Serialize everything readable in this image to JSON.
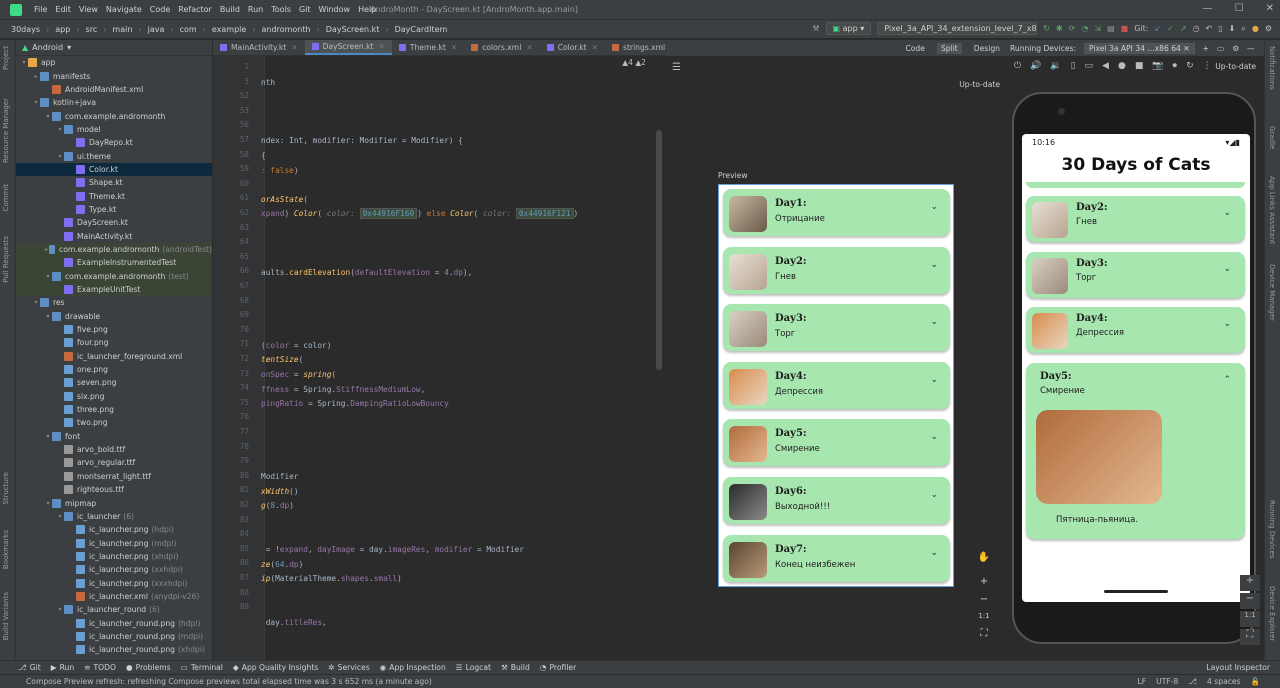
{
  "menu": {
    "items": [
      "File",
      "Edit",
      "View",
      "Navigate",
      "Code",
      "Refactor",
      "Build",
      "Run",
      "Tools",
      "Git",
      "Window",
      "Help"
    ],
    "title": "AndroMonth - DayScreen.kt [AndroMonth.app.main]"
  },
  "breadcrumb": [
    "30days",
    "app",
    "src",
    "main",
    "java",
    "com",
    "example",
    "andromonth",
    "DayScreen.kt",
    "DayCardItem"
  ],
  "toolbar": {
    "config": "app",
    "device": "Pixel_3a_API_34_extension_level_7_x86_64",
    "git": "Git:"
  },
  "project": {
    "view": "Android"
  },
  "tree": [
    {
      "l": "app",
      "d": 0,
      "a": "▾",
      "c": "#e8a84a"
    },
    {
      "l": "manifests",
      "d": 1,
      "a": "▸",
      "c": "#5d8fc4"
    },
    {
      "l": "AndroidManifest.xml",
      "d": 2,
      "a": "",
      "c": "#c46a3e"
    },
    {
      "l": "kotlin+java",
      "d": 1,
      "a": "▾",
      "c": "#5d8fc4"
    },
    {
      "l": "com.example.andromonth",
      "d": 2,
      "a": "▾",
      "c": "#5d8fc4"
    },
    {
      "l": "model",
      "d": 3,
      "a": "▾",
      "c": "#5d8fc4"
    },
    {
      "l": "DayRepo.kt",
      "d": 4,
      "a": "",
      "c": "#7f6df2"
    },
    {
      "l": "ui.theme",
      "d": 3,
      "a": "▾",
      "c": "#5d8fc4"
    },
    {
      "l": "Color.kt",
      "d": 4,
      "a": "",
      "c": "#7f6df2",
      "sel": true
    },
    {
      "l": "Shape.kt",
      "d": 4,
      "a": "",
      "c": "#7f6df2"
    },
    {
      "l": "Theme.kt",
      "d": 4,
      "a": "",
      "c": "#7f6df2"
    },
    {
      "l": "Type.kt",
      "d": 4,
      "a": "",
      "c": "#7f6df2"
    },
    {
      "l": "DayScreen.kt",
      "d": 3,
      "a": "",
      "c": "#7f6df2"
    },
    {
      "l": "MainActivity.kt",
      "d": 3,
      "a": "",
      "c": "#7f6df2"
    },
    {
      "l": "com.example.andromonth",
      "d": 2,
      "a": "▸",
      "c": "#5d8fc4",
      "hint": "(androidTest)",
      "test": true
    },
    {
      "l": "ExampleInstrumentedTest",
      "d": 3,
      "a": "",
      "c": "#7f6df2",
      "test": true
    },
    {
      "l": "com.example.andromonth",
      "d": 2,
      "a": "▾",
      "c": "#5d8fc4",
      "hint": "(test)",
      "test": true
    },
    {
      "l": "ExampleUnitTest",
      "d": 3,
      "a": "",
      "c": "#7f6df2",
      "test": true
    },
    {
      "l": "res",
      "d": 1,
      "a": "▾",
      "c": "#5d8fc4"
    },
    {
      "l": "drawable",
      "d": 2,
      "a": "▾",
      "c": "#5d8fc4"
    },
    {
      "l": "five.png",
      "d": 3,
      "a": "",
      "c": "#6a9fd4"
    },
    {
      "l": "four.png",
      "d": 3,
      "a": "",
      "c": "#6a9fd4"
    },
    {
      "l": "ic_launcher_foreground.xml",
      "d": 3,
      "a": "",
      "c": "#c46a3e"
    },
    {
      "l": "one.png",
      "d": 3,
      "a": "",
      "c": "#6a9fd4"
    },
    {
      "l": "seven.png",
      "d": 3,
      "a": "",
      "c": "#6a9fd4"
    },
    {
      "l": "six.png",
      "d": 3,
      "a": "",
      "c": "#6a9fd4"
    },
    {
      "l": "three.png",
      "d": 3,
      "a": "",
      "c": "#6a9fd4"
    },
    {
      "l": "two.png",
      "d": 3,
      "a": "",
      "c": "#6a9fd4"
    },
    {
      "l": "font",
      "d": 2,
      "a": "▾",
      "c": "#5d8fc4"
    },
    {
      "l": "arvo_bold.ttf",
      "d": 3,
      "a": "",
      "c": "#9a9a9a"
    },
    {
      "l": "arvo_regular.ttf",
      "d": 3,
      "a": "",
      "c": "#9a9a9a"
    },
    {
      "l": "montserrat_light.ttf",
      "d": 3,
      "a": "",
      "c": "#9a9a9a"
    },
    {
      "l": "righteous.ttf",
      "d": 3,
      "a": "",
      "c": "#9a9a9a"
    },
    {
      "l": "mipmap",
      "d": 2,
      "a": "▾",
      "c": "#5d8fc4"
    },
    {
      "l": "ic_launcher",
      "d": 3,
      "a": "▾",
      "c": "#5d8fc4",
      "hint": "(6)"
    },
    {
      "l": "ic_launcher.png",
      "d": 4,
      "a": "",
      "c": "#6a9fd4",
      "hint": "(hdpi)"
    },
    {
      "l": "ic_launcher.png",
      "d": 4,
      "a": "",
      "c": "#6a9fd4",
      "hint": "(mdpi)"
    },
    {
      "l": "ic_launcher.png",
      "d": 4,
      "a": "",
      "c": "#6a9fd4",
      "hint": "(xhdpi)"
    },
    {
      "l": "ic_launcher.png",
      "d": 4,
      "a": "",
      "c": "#6a9fd4",
      "hint": "(xxhdpi)"
    },
    {
      "l": "ic_launcher.png",
      "d": 4,
      "a": "",
      "c": "#6a9fd4",
      "hint": "(xxxhdpi)"
    },
    {
      "l": "ic_launcher.xml",
      "d": 4,
      "a": "",
      "c": "#c46a3e",
      "hint": "(anydpi-v26)"
    },
    {
      "l": "ic_launcher_round",
      "d": 3,
      "a": "▾",
      "c": "#5d8fc4",
      "hint": "(6)"
    },
    {
      "l": "ic_launcher_round.png",
      "d": 4,
      "a": "",
      "c": "#6a9fd4",
      "hint": "(hdpi)"
    },
    {
      "l": "ic_launcher_round.png",
      "d": 4,
      "a": "",
      "c": "#6a9fd4",
      "hint": "(mdpi)"
    },
    {
      "l": "ic_launcher_round.png",
      "d": 4,
      "a": "",
      "c": "#6a9fd4",
      "hint": "(xhdpi)"
    }
  ],
  "tabs": [
    "MainActivity.kt",
    "DayScreen.kt",
    "Theme.kt",
    "colors.xml",
    "Color.kt",
    "strings.xml",
    "themes.xml"
  ],
  "editor": {
    "warnings": "▲4 ▲2",
    "lines": [
      "1",
      "3",
      "52",
      "53",
      "56",
      "57",
      "58",
      "59",
      "60",
      "61",
      "62",
      "63",
      "64",
      "65",
      "66",
      "67",
      "68",
      "69",
      "70",
      "71",
      "72",
      "73",
      "74",
      "75",
      "76",
      "77",
      "78",
      "79",
      "80",
      "81",
      "82",
      "83",
      "84",
      "85",
      "86",
      "87",
      "88",
      "89"
    ],
    "code": [
      {
        "n": "1",
        "h": "<span class='t'>nth</span>"
      },
      {
        "n": "3",
        "h": ""
      },
      {
        "n": "52",
        "h": ""
      },
      {
        "n": "53",
        "h": ""
      },
      {
        "n": "56",
        "h": "<span class='t'>ndex: </span><span class='t'>Int, modifier: Modifier = Modifier) {</span>"
      },
      {
        "n": "57",
        "h": "<span class='t'>{</span>"
      },
      {
        "n": "58",
        "h": "<span class='lbl'>: </span><span class='k'>false</span><span class='t'>)</span>"
      },
      {
        "n": "59",
        "h": ""
      },
      {
        "n": "60",
        "h": "<span class='f'>orAsState</span><span class='t'>(</span>"
      },
      {
        "n": "61",
        "h": "<span class='p'>xpand</span><span class='t'>) </span><span class='f'>Color</span><span class='t'>( </span><span class='lbl'>color: </span><span class='chip'>0x44916F160</span><span class='t'>) </span><span class='k'>else </span><span class='f'>Color</span><span class='t'>( </span><span class='lbl'>color: </span><span class='chip'>0x44916F121</span><span class='t'>)</span>"
      },
      {
        "n": "62",
        "h": ""
      },
      {
        "n": "63",
        "h": ""
      },
      {
        "n": "64",
        "h": ""
      },
      {
        "n": "65",
        "h": "<span class='t'>aults.</span><span class='fn'>cardElevation</span><span class='t'>(</span><span class='p'>defaultElevation </span><span class='t'>= </span><span class='n'>4</span><span class='t'>.</span><span class='p'>dp</span><span class='t'>),</span>"
      },
      {
        "n": "66",
        "h": ""
      },
      {
        "n": "67",
        "h": ""
      },
      {
        "n": "68",
        "h": ""
      },
      {
        "n": "69",
        "h": ""
      },
      {
        "n": "70",
        "h": "<span class='t'>(</span><span class='p'>color </span><span class='t'>= color)</span>"
      },
      {
        "n": "71",
        "h": "<span class='f'>tentSize</span><span class='t'>(</span>"
      },
      {
        "n": "72",
        "h": "<span class='p'>onSpec </span><span class='t'>= </span><span class='f'>spring</span><span class='t'>(</span>"
      },
      {
        "n": "73",
        "h": "<span class='p'>ffness </span><span class='t'>= Spring.</span><span class='p'>StiffnessMediumLow</span><span class='t'>,</span>"
      },
      {
        "n": "74",
        "h": "<span class='p'>pingRatio </span><span class='t'>= Spring.</span><span class='p'>DampingRatioLowBouncy</span>"
      },
      {
        "n": "75",
        "h": ""
      },
      {
        "n": "76",
        "h": ""
      },
      {
        "n": "77",
        "h": ""
      },
      {
        "n": "78",
        "h": ""
      },
      {
        "n": "79",
        "h": "<span class='t'>Modifier</span>"
      },
      {
        "n": "80",
        "h": "<span class='f'>xWidth</span><span class='t'>()</span>"
      },
      {
        "n": "81",
        "h": "<span class='f'>g</span><span class='t'>(</span><span class='n'>8</span><span class='t'>.</span><span class='p'>dp</span><span class='t'>)</span>"
      },
      {
        "n": "82",
        "h": ""
      },
      {
        "n": "83",
        "h": ""
      },
      {
        "n": "84",
        "h": "<span class='t'> = !</span><span class='p'>expand</span><span class='t'>, </span><span class='p'>dayImage </span><span class='t'>= day.</span><span class='p'>imageRes</span><span class='t'>, </span><span class='p'>modifier </span><span class='t'>= Modifier</span>"
      },
      {
        "n": "85",
        "h": "<span class='f'>ze</span><span class='t'>(</span><span class='n'>64</span><span class='t'>.</span><span class='p'>dp</span><span class='t'>)</span>"
      },
      {
        "n": "86",
        "h": "<span class='f'>ip</span><span class='t'>(MaterialTheme.</span><span class='p'>shapes</span><span class='t'>.</span><span class='p'>small</span><span class='t'>)</span>"
      },
      {
        "n": "87",
        "h": ""
      },
      {
        "n": "88",
        "h": ""
      },
      {
        "n": "89",
        "h": "<span class='t'> day.</span><span class='p'>titleRes</span><span class='t'>,</span>"
      }
    ]
  },
  "preview": {
    "code": "Code",
    "split": "Split",
    "design": "Design",
    "uptodate": "Up-to-date",
    "label": "Preview",
    "cards": [
      {
        "day": "Day1:",
        "sub": "Отрицание",
        "cat": "cat1"
      },
      {
        "day": "Day2:",
        "sub": "Гнев",
        "cat": "cat2"
      },
      {
        "day": "Day3:",
        "sub": "Торг",
        "cat": "cat3"
      },
      {
        "day": "Day4:",
        "sub": "Депрессия",
        "cat": "cat4"
      },
      {
        "day": "Day5:",
        "sub": "Смирение",
        "cat": "cat5"
      },
      {
        "day": "Day6:",
        "sub": "Выходной!!!",
        "cat": "cat6"
      },
      {
        "day": "Day7:",
        "sub": "Конец неизбежен",
        "cat": "cat7"
      }
    ],
    "zoom": [
      "+",
      "−",
      "1:1"
    ]
  },
  "devices": {
    "label": "Running Devices:",
    "tab": "Pixel 3a API 34 ...x86 64",
    "uptodate": "Up-to-date"
  },
  "phone": {
    "time": "10:16",
    "title": "30 Days of Cats",
    "cards": [
      {
        "day": "Day2:",
        "sub": "Гнев",
        "cat": "cat2"
      },
      {
        "day": "Day3:",
        "sub": "Торг",
        "cat": "cat3"
      },
      {
        "day": "Day4:",
        "sub": "Депрессия",
        "cat": "cat4"
      }
    ],
    "expanded": {
      "day": "Day5:",
      "sub": "Смирение",
      "desc": "Пятница-пьяница."
    }
  },
  "bottombar": [
    "Git",
    "Run",
    "TODO",
    "Problems",
    "Terminal",
    "App Quality Insights",
    "Services",
    "App Inspection",
    "Logcat",
    "Build",
    "Profiler"
  ],
  "layout_inspector": "Layout Inspector",
  "status": {
    "msg": "Compose Preview refresh: refreshing Compose previews total elapsed time was 3 s 652 ms (a minute ago)",
    "lf": "LF",
    "enc": "UTF-8",
    "spaces": "4 spaces"
  },
  "left_strip": [
    "Project",
    "Resource Manager",
    "Commit",
    "Pull Requests",
    "Structure",
    "Bookmarks",
    "Build Variants"
  ],
  "right_strip": [
    "Notifications",
    "Gradle",
    "App Links Assistant",
    "Device Manager",
    "Running Devices",
    "Device Explorer"
  ]
}
